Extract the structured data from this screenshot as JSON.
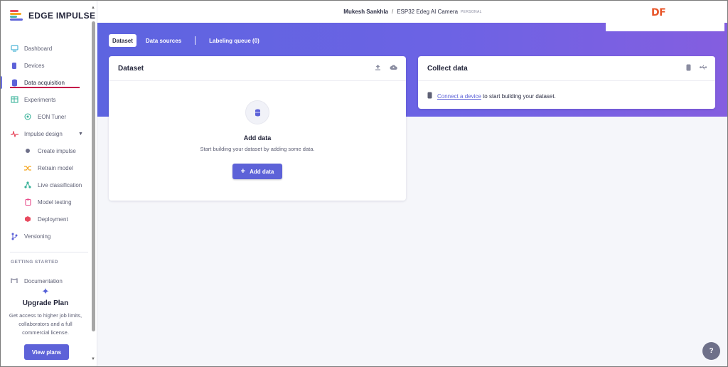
{
  "app": {
    "name": "EDGE IMPULSE"
  },
  "header": {
    "user": "Mukesh Sankhla",
    "separator": "/",
    "project": "ESP32 Edeg AI Camera",
    "badge": "PERSONAL",
    "corner_logo": "DF"
  },
  "sidebar": {
    "items": [
      {
        "label": "Dashboard",
        "icon": "monitor-icon"
      },
      {
        "label": "Devices",
        "icon": "device-icon"
      },
      {
        "label": "Data acquisition",
        "icon": "database-icon",
        "active": true
      },
      {
        "label": "Experiments",
        "icon": "table-icon"
      },
      {
        "label": "EON Tuner",
        "icon": "tuner-icon"
      },
      {
        "label": "Impulse design",
        "icon": "pulse-icon"
      },
      {
        "label": "Create impulse",
        "icon": "dot-icon"
      },
      {
        "label": "Retrain model",
        "icon": "shuffle-icon"
      },
      {
        "label": "Live classification",
        "icon": "nodes-icon"
      },
      {
        "label": "Model testing",
        "icon": "clipboard-icon"
      },
      {
        "label": "Deployment",
        "icon": "box-icon"
      },
      {
        "label": "Versioning",
        "icon": "branch-icon"
      }
    ],
    "section_label": "GETTING STARTED",
    "documentation": "Documentation",
    "upgrade": {
      "title": "Upgrade Plan",
      "text": "Get access to higher job limits, collaborators and a full commercial license.",
      "button": "View plans"
    }
  },
  "tabs": [
    {
      "label": "Dataset",
      "active": true
    },
    {
      "label": "Data sources"
    },
    {
      "label": "Labeling queue (0)"
    }
  ],
  "dataset_card": {
    "title": "Dataset",
    "empty_title": "Add data",
    "empty_text": "Start building your dataset by adding some data.",
    "button": "Add data"
  },
  "collect_card": {
    "title": "Collect data",
    "link": "Connect a device",
    "text": "to start building your dataset."
  },
  "help_label": "?",
  "colors": {
    "accent": "#5d62d8",
    "banner_start": "#5d64e0",
    "banner_end": "#845ee0",
    "active_underline": "#c4004a"
  }
}
